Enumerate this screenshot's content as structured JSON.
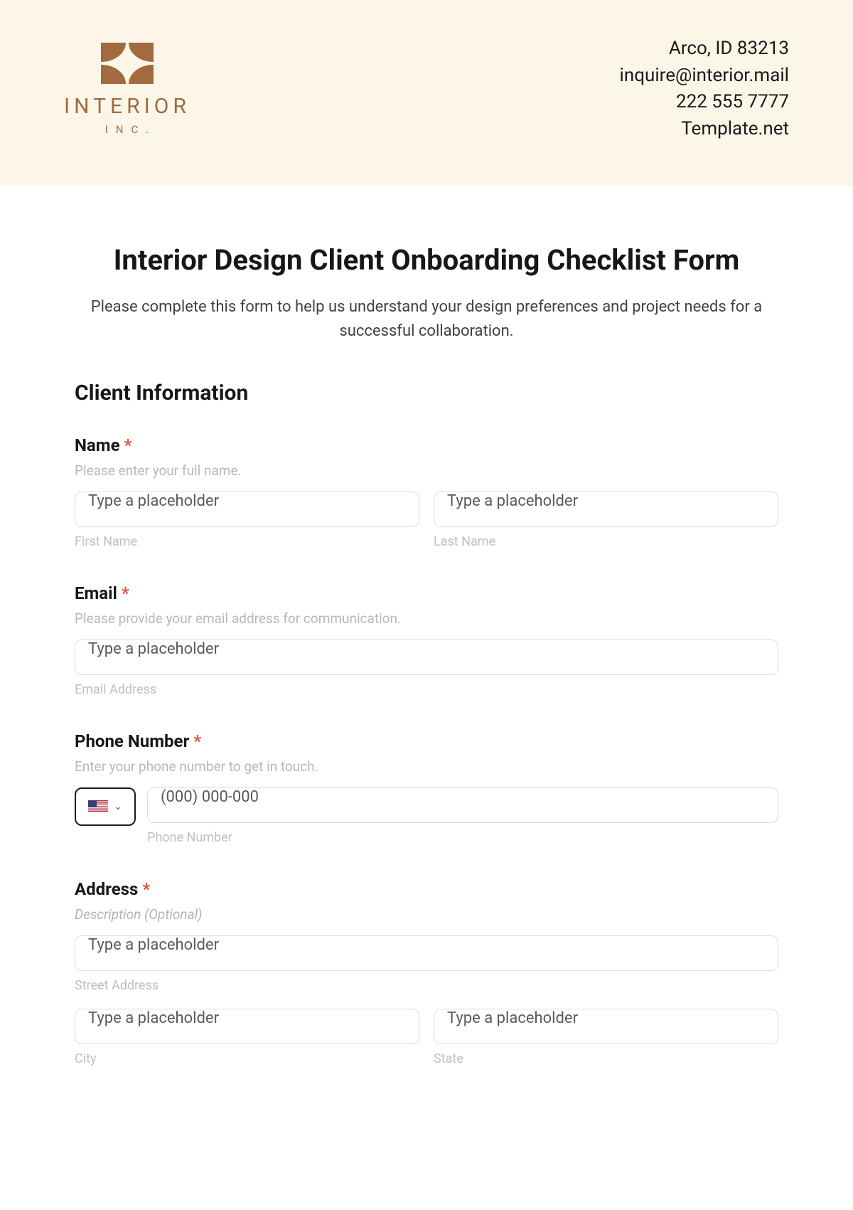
{
  "header": {
    "logo": {
      "word": "INTERIOR",
      "sub": "INC."
    },
    "contact": {
      "line1": "Arco, ID 83213",
      "line2": "inquire@interior.mail",
      "line3": "222 555 7777",
      "line4": "Template.net"
    }
  },
  "form": {
    "title": "Interior Design Client Onboarding Checklist Form",
    "intro": "Please complete this form to help us understand your design preferences and project needs for a successful collaboration.",
    "section1": "Client Information",
    "name": {
      "label": "Name",
      "help": "Please enter your full name.",
      "first_placeholder": "Type a placeholder",
      "first_sub": "First Name",
      "last_placeholder": "Type a placeholder",
      "last_sub": "Last Name"
    },
    "email": {
      "label": "Email",
      "help": "Please provide your email address for communication.",
      "placeholder": "Type a placeholder",
      "sub": "Email Address"
    },
    "phone": {
      "label": "Phone Number",
      "help": "Enter your phone number to get in touch.",
      "placeholder": "(000) 000-000",
      "sub": "Phone Number"
    },
    "address": {
      "label": "Address",
      "help": "Description (Optional)",
      "street_placeholder": "Type a placeholder",
      "street_sub": "Street Address",
      "city_placeholder": "Type a placeholder",
      "city_sub": "City",
      "state_placeholder": "Type a placeholder",
      "state_sub": "State"
    },
    "required_mark": "*"
  }
}
